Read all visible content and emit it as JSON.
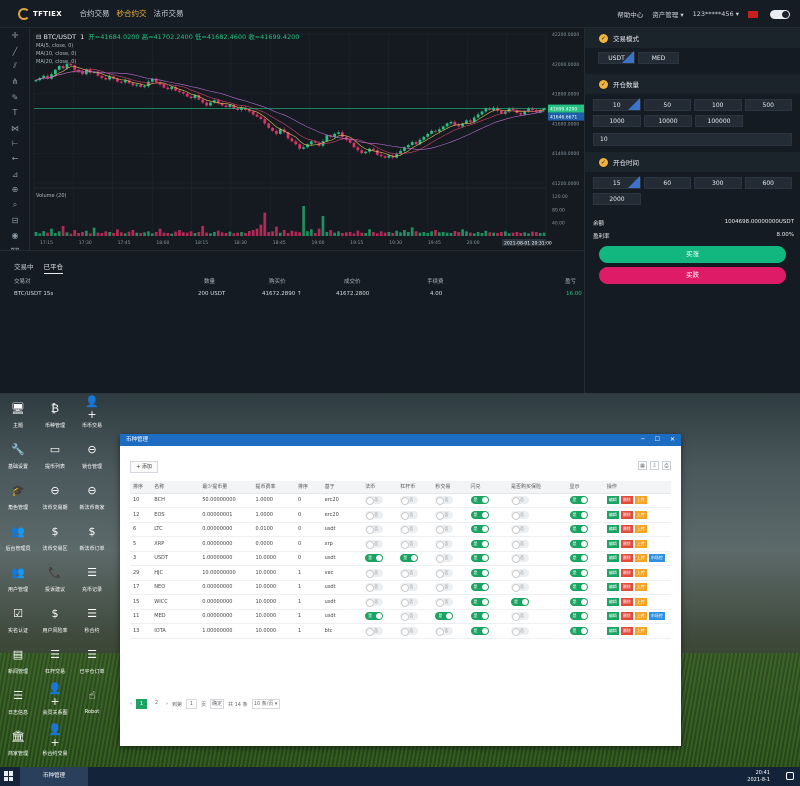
{
  "brand": {
    "logo_text": "TFTIEX"
  },
  "nav": {
    "tabs": [
      "合约交易",
      "秒合约交易",
      "法币交易"
    ],
    "active_tab": 1,
    "help": "帮助中心",
    "assets": "资产管理 ▾",
    "user": "123*****456 ▾"
  },
  "chart_data": {
    "type": "candlestick",
    "title": "BTC/USDT",
    "interval": "1",
    "ohlc_text": "开=41684.0200  高=41702.2400  低=41682.4600  收=41699.4200",
    "ma": [
      "MA(5, close, 0)",
      "MA(10, close, 0)",
      "MA(20, close, 0)"
    ],
    "volume_label": "Volume (20)",
    "ylim": [
      41200,
      42200
    ],
    "y_ticks": [
      42200,
      42000,
      41800,
      41600,
      41400,
      41200
    ],
    "last_price": 41699.42,
    "last_price_label": "41699.4200",
    "last_price_label_2": "41646.6671",
    "volume_ticks": [
      "120.00",
      "80.00",
      "40.00"
    ],
    "x_ticks": [
      "17:15",
      "17:30",
      "17:45",
      "18:00",
      "18:15",
      "18:30",
      "18:45",
      "19:00",
      "19:15",
      "19:30",
      "19:45",
      "20:00",
      "20:15"
    ],
    "crosshair_time": "2021-08-01 20:31:00",
    "close": [
      41890,
      41905,
      41920,
      41900,
      41930,
      41960,
      41985,
      41970,
      42000,
      41990,
      41960,
      41950,
      41930,
      41960,
      41940,
      41945,
      41920,
      41905,
      41895,
      41915,
      41900,
      41880,
      41875,
      41890,
      41870,
      41855,
      41860,
      41845,
      41850,
      41880,
      41900,
      41875,
      41860,
      41840,
      41830,
      41845,
      41820,
      41810,
      41800,
      41780,
      41770,
      41790,
      41760,
      41740,
      41720,
      41740,
      41755,
      41735,
      41720,
      41710,
      41725,
      41700,
      41690,
      41705,
      41690,
      41680,
      41660,
      41645,
      41630,
      41600,
      41570,
      41550,
      41530,
      41560,
      41540,
      41500,
      41480,
      41460,
      41430,
      41440,
      41460,
      41480,
      41470,
      41450,
      41480,
      41520,
      41510,
      41530,
      41540,
      41510,
      41490,
      41470,
      41440,
      41420,
      41400,
      41410,
      41430,
      41420,
      41390,
      41380,
      41370,
      41385,
      41370,
      41395,
      41415,
      41440,
      41455,
      41475,
      41460,
      41490,
      41510,
      41530,
      41550,
      41545,
      41560,
      41580,
      41600,
      41610,
      41590,
      41580,
      41600,
      41620,
      41610,
      41640,
      41660,
      41680,
      41700,
      41690,
      41705,
      41685,
      41665,
      41680,
      41700,
      41690,
      41670,
      41660,
      41680,
      41700,
      41690,
      41675,
      41690,
      41700
    ],
    "volume": [
      12,
      8,
      15,
      10,
      22,
      9,
      14,
      30,
      11,
      7,
      18,
      9,
      12,
      16,
      8,
      25,
      10,
      9,
      14,
      12,
      9,
      20,
      11,
      8,
      13,
      18,
      10,
      9,
      11,
      14,
      8,
      12,
      22,
      10,
      9,
      7,
      13,
      18,
      11,
      10,
      14,
      9,
      12,
      30,
      10,
      8,
      12,
      16,
      11,
      9,
      13,
      8,
      10,
      12,
      9,
      15,
      18,
      22,
      34,
      70,
      12,
      14,
      28,
      10,
      18,
      9,
      16,
      13,
      11,
      90,
      14,
      20,
      9,
      22,
      60,
      12,
      18,
      10,
      14,
      9,
      11,
      12,
      8,
      16,
      10,
      9,
      20,
      12,
      8,
      14,
      10,
      12,
      9,
      16,
      11,
      18,
      12,
      26,
      14,
      10,
      12,
      9,
      14,
      18,
      11,
      12,
      10,
      9,
      15,
      12,
      20,
      14,
      10,
      8,
      12,
      9,
      16,
      11,
      10,
      9,
      12,
      14,
      8,
      10,
      12,
      9,
      11,
      8,
      13,
      12,
      9,
      10
    ]
  },
  "panel": {
    "mode_title": "交易模式",
    "mode_options": [
      "USDT",
      "MED"
    ],
    "amount_title": "开仓数量",
    "amount_options": [
      "10",
      "50",
      "100",
      "500",
      "1000",
      "10000",
      "100000"
    ],
    "amount_value": "10",
    "time_title": "开仓时间",
    "time_options": [
      "15",
      "60",
      "300",
      "600",
      "2000"
    ],
    "balance_label": "余额",
    "balance_value": "1004698.00000000USDT",
    "profit_label": "盈利率",
    "profit_value": "8.00%",
    "buy": "买涨",
    "sell": "买跌"
  },
  "orders": {
    "tabs": [
      "交易中",
      "已平仓"
    ],
    "active": 1,
    "headers": [
      "交易对",
      "数量",
      "购买价",
      "成交价",
      "手续费",
      "盈亏"
    ],
    "rows": [
      [
        "BTC/USDT 15s",
        "200 USDT",
        "41672.2890 ↑",
        "41672.2800",
        "4.00",
        "16.00"
      ]
    ]
  },
  "desktop": {
    "icons": [
      {
        "label": "主题",
        "glyph": "🖥",
        "icon": "monitor-icon"
      },
      {
        "label": "币种管理",
        "glyph": "₿",
        "icon": "bitcoin-icon"
      },
      {
        "label": "币币交易",
        "glyph": "👤+",
        "icon": "add-user-icon"
      },
      {
        "label": "基础设置",
        "glyph": "🔧",
        "icon": "wrench-icon"
      },
      {
        "label": "提币列表",
        "glyph": "▭",
        "icon": "card-icon"
      },
      {
        "label": "锁仓管理",
        "glyph": "⊖",
        "icon": "lock-circle-icon"
      },
      {
        "label": "角色管理",
        "glyph": "🎓",
        "icon": "graduation-icon"
      },
      {
        "label": "法币交易期",
        "glyph": "⊖",
        "icon": "swap-icon"
      },
      {
        "label": "新法币商家",
        "glyph": "⊖",
        "icon": "merchant-icon"
      },
      {
        "label": "后台管理员",
        "glyph": "👥",
        "icon": "users-icon"
      },
      {
        "label": "法币交易区",
        "glyph": "$",
        "icon": "dollar-icon"
      },
      {
        "label": "新法币订单",
        "glyph": "$",
        "icon": "dollar-order-icon"
      },
      {
        "label": "用户管理",
        "glyph": "👥",
        "icon": "user-manage-icon"
      },
      {
        "label": "投诉建议",
        "glyph": "📞",
        "icon": "phone-icon"
      },
      {
        "label": "充币记录",
        "glyph": "☰",
        "icon": "list-icon"
      },
      {
        "label": "实名认证",
        "glyph": "☑",
        "icon": "check-icon"
      },
      {
        "label": "用户风险率",
        "glyph": "$",
        "icon": "risk-icon"
      },
      {
        "label": "秒合约",
        "glyph": "☰",
        "icon": "seconds-icon"
      },
      {
        "label": "新闻管理",
        "glyph": "▤",
        "icon": "news-icon"
      },
      {
        "label": "杠杆交易",
        "glyph": "☰",
        "icon": "leverage-icon"
      },
      {
        "label": "已平仓订单",
        "glyph": "☰",
        "icon": "closed-orders-icon"
      },
      {
        "label": "日志信息",
        "glyph": "☰",
        "icon": "log-icon"
      },
      {
        "label": "会员关系图",
        "glyph": "👤+",
        "icon": "relation-icon"
      },
      {
        "label": "Robot",
        "glyph": "☝",
        "icon": "robot-icon"
      },
      {
        "label": "商家管理",
        "glyph": "🏛",
        "icon": "bank-icon"
      },
      {
        "label": "秒合约交易",
        "glyph": "👤+",
        "icon": "contract-icon"
      }
    ]
  },
  "window": {
    "title": "币种管理",
    "add_label": "添加",
    "headers": [
      "排序",
      "名称",
      "最少提币量",
      "提币费率",
      "排序",
      "基于",
      "法币",
      "杠杆币",
      "秒交易",
      "闪兑",
      "是否购买保险",
      "显示",
      "操作"
    ],
    "rows": [
      {
        "id": "10",
        "name": "BCH",
        "min": "50.00000000",
        "fee": "1.0000",
        "sort": "0",
        "base": "erc20",
        "fiat": 0,
        "lev": 0,
        "sec": 0,
        "flash": 1,
        "ins": 0,
        "show": 1,
        "ctl": false
      },
      {
        "id": "12",
        "name": "EOS",
        "min": "0.00000001",
        "fee": "1.0000",
        "sort": "0",
        "base": "erc20",
        "fiat": 0,
        "lev": 0,
        "sec": 0,
        "flash": 1,
        "ins": 0,
        "show": 1,
        "ctl": false
      },
      {
        "id": "6",
        "name": "LTC",
        "min": "0.00000000",
        "fee": "0.0100",
        "sort": "0",
        "base": "usdt",
        "fiat": 0,
        "lev": 0,
        "sec": 0,
        "flash": 1,
        "ins": 0,
        "show": 1,
        "ctl": false
      },
      {
        "id": "5",
        "name": "XRP",
        "min": "0.00000000",
        "fee": "0.0000",
        "sort": "0",
        "base": "xrp",
        "fiat": 0,
        "lev": 0,
        "sec": 0,
        "flash": 1,
        "ins": 0,
        "show": 1,
        "ctl": false
      },
      {
        "id": "3",
        "name": "USDT",
        "min": "1.00000000",
        "fee": "10.0000",
        "sort": "0",
        "base": "usdt",
        "fiat": 1,
        "lev": 1,
        "sec": 0,
        "flash": 1,
        "ins": 0,
        "show": 1,
        "ctl": true
      },
      {
        "id": "29",
        "name": "HJC",
        "min": "10.00000000",
        "fee": "10.0000",
        "sort": "1",
        "base": "vec",
        "fiat": 0,
        "lev": 0,
        "sec": 0,
        "flash": 1,
        "ins": 0,
        "show": 1,
        "ctl": false
      },
      {
        "id": "17",
        "name": "NEO",
        "min": "0.00000000",
        "fee": "10.0000",
        "sort": "1",
        "base": "usdt",
        "fiat": 0,
        "lev": 0,
        "sec": 0,
        "flash": 1,
        "ins": 0,
        "show": 1,
        "ctl": false
      },
      {
        "id": "15",
        "name": "WICC",
        "min": "0.00000000",
        "fee": "10.0000",
        "sort": "1",
        "base": "usdt",
        "fiat": 0,
        "lev": 0,
        "sec": 0,
        "flash": 1,
        "ins": 1,
        "show": 1,
        "ctl": false
      },
      {
        "id": "11",
        "name": "MED",
        "min": "0.00000000",
        "fee": "10.0000",
        "sort": "1",
        "base": "usdt",
        "fiat": 1,
        "lev": 0,
        "sec": 1,
        "flash": 1,
        "ins": 0,
        "show": 1,
        "ctl": true
      },
      {
        "id": "13",
        "name": "IOTA",
        "min": "1.00000000",
        "fee": "10.0000",
        "sort": "1",
        "base": "btc",
        "fiat": 0,
        "lev": 0,
        "sec": 0,
        "flash": 1,
        "ins": 0,
        "show": 1,
        "ctl": false
      }
    ],
    "switch_on": "是",
    "switch_off": "否",
    "actions": {
      "edit": "编辑",
      "del": "删除",
      "up": "上传",
      "ctl": "市场控"
    },
    "pager": {
      "pages": [
        "1",
        "2"
      ],
      "goto": "到第",
      "page": "1",
      "unit": "页",
      "confirm": "确定",
      "total": "共 14 条",
      "per_page": "10 条/页 ▾"
    }
  },
  "taskbar": {
    "task": "币种管理",
    "time": "20:41",
    "date": "2021-8-1"
  }
}
